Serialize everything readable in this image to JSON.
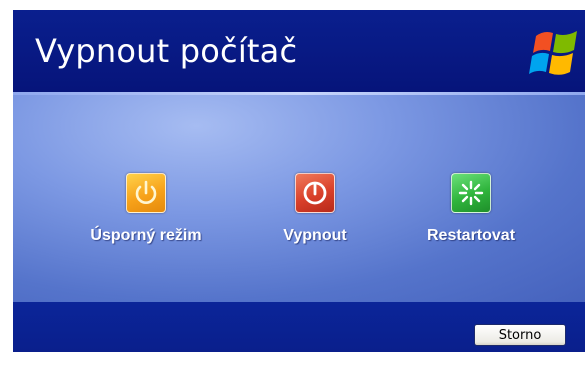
{
  "dialog": {
    "title": "Vypnout počítač",
    "logo_icon": "windows-flag-icon",
    "options": [
      {
        "label": "Úsporný režim",
        "icon": "power-standby-icon",
        "color": "#f7a21a"
      },
      {
        "label": "Vypnout",
        "icon": "power-off-icon",
        "color": "#d9402a"
      },
      {
        "label": "Restartovat",
        "icon": "restart-icon",
        "color": "#2fb43c"
      }
    ],
    "cancel_label": "Storno"
  },
  "colors": {
    "title_bar": "#0a1f8e",
    "body": "#7c98e3",
    "bottom_bar": "#0b2599"
  }
}
